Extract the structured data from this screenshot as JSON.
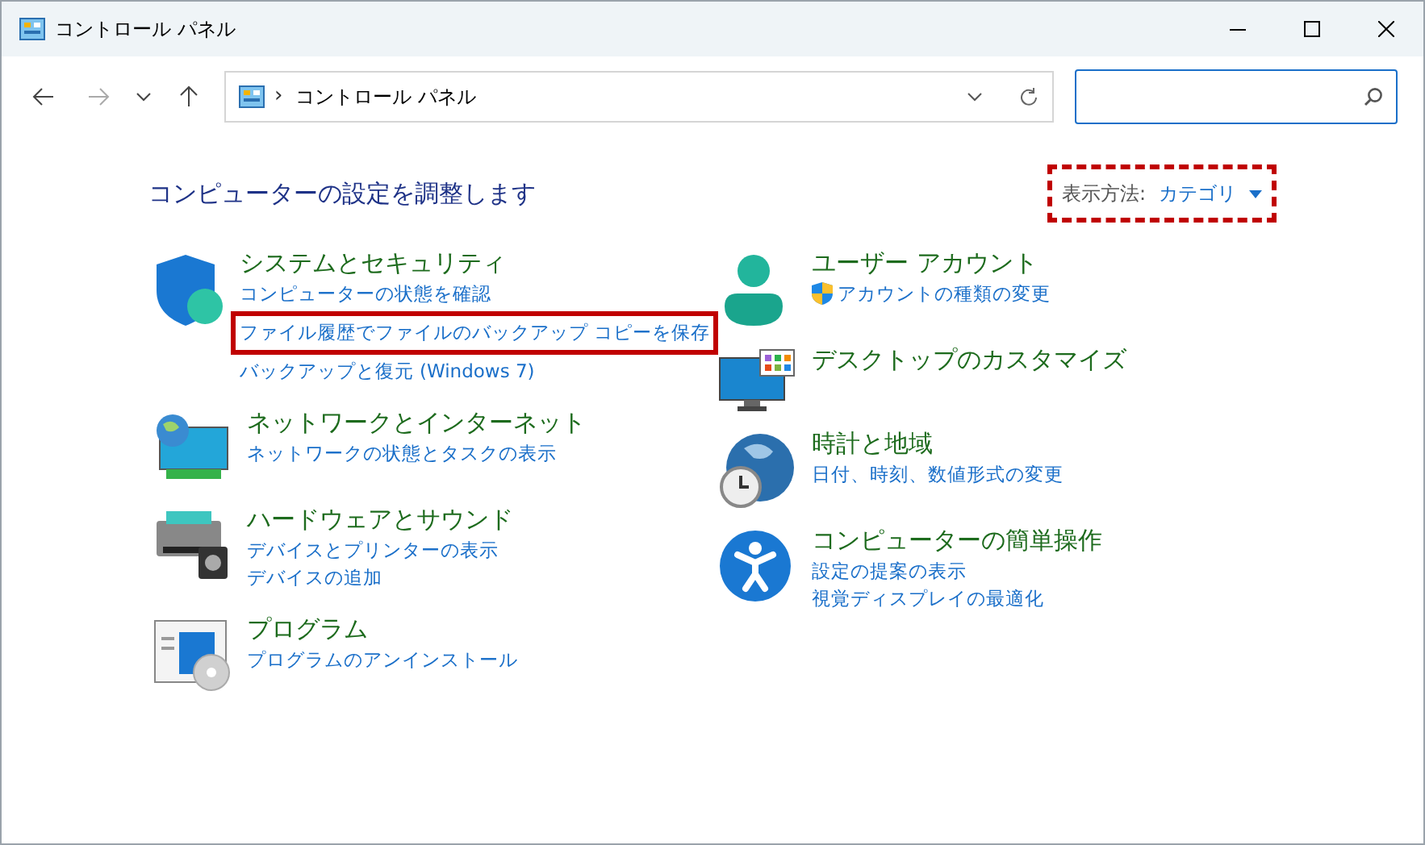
{
  "window": {
    "title": "コントロール パネル"
  },
  "address_bar": {
    "separator": "›",
    "path": "コントロール パネル"
  },
  "heading": "コンピューターの設定を調整します",
  "view_by": {
    "label": "表示方法:",
    "value": "カテゴリ",
    "highlighted": true
  },
  "columns": [
    {
      "categories": [
        {
          "title": "システムとセキュリティ",
          "links": [
            {
              "text": "コンピューターの状態を確認",
              "highlighted": false,
              "shield": false
            },
            {
              "text": "ファイル履歴でファイルのバックアップ コピーを保存",
              "highlighted": true,
              "shield": false
            },
            {
              "text": "バックアップと復元 (Windows 7)",
              "highlighted": false,
              "shield": false
            }
          ]
        },
        {
          "title": "ネットワークとインターネット",
          "links": [
            {
              "text": "ネットワークの状態とタスクの表示",
              "highlighted": false,
              "shield": false
            }
          ]
        },
        {
          "title": "ハードウェアとサウンド",
          "links": [
            {
              "text": "デバイスとプリンターの表示",
              "highlighted": false,
              "shield": false
            },
            {
              "text": "デバイスの追加",
              "highlighted": false,
              "shield": false
            }
          ]
        },
        {
          "title": "プログラム",
          "links": [
            {
              "text": "プログラムのアンインストール",
              "highlighted": false,
              "shield": false
            }
          ]
        }
      ]
    },
    {
      "categories": [
        {
          "title": "ユーザー アカウント",
          "links": [
            {
              "text": "アカウントの種類の変更",
              "highlighted": false,
              "shield": true
            }
          ]
        },
        {
          "title": "デスクトップのカスタマイズ"
        },
        {
          "title": "時計と地域",
          "links": [
            {
              "text": "日付、時刻、数値形式の変更",
              "highlighted": false,
              "shield": false
            }
          ]
        },
        {
          "title": "コンピューターの簡単操作",
          "links": [
            {
              "text": "設定の提案の表示",
              "highlighted": false,
              "shield": false
            },
            {
              "text": "視覚ディスプレイの最適化",
              "highlighted": false,
              "shield": false
            }
          ]
        }
      ]
    }
  ]
}
